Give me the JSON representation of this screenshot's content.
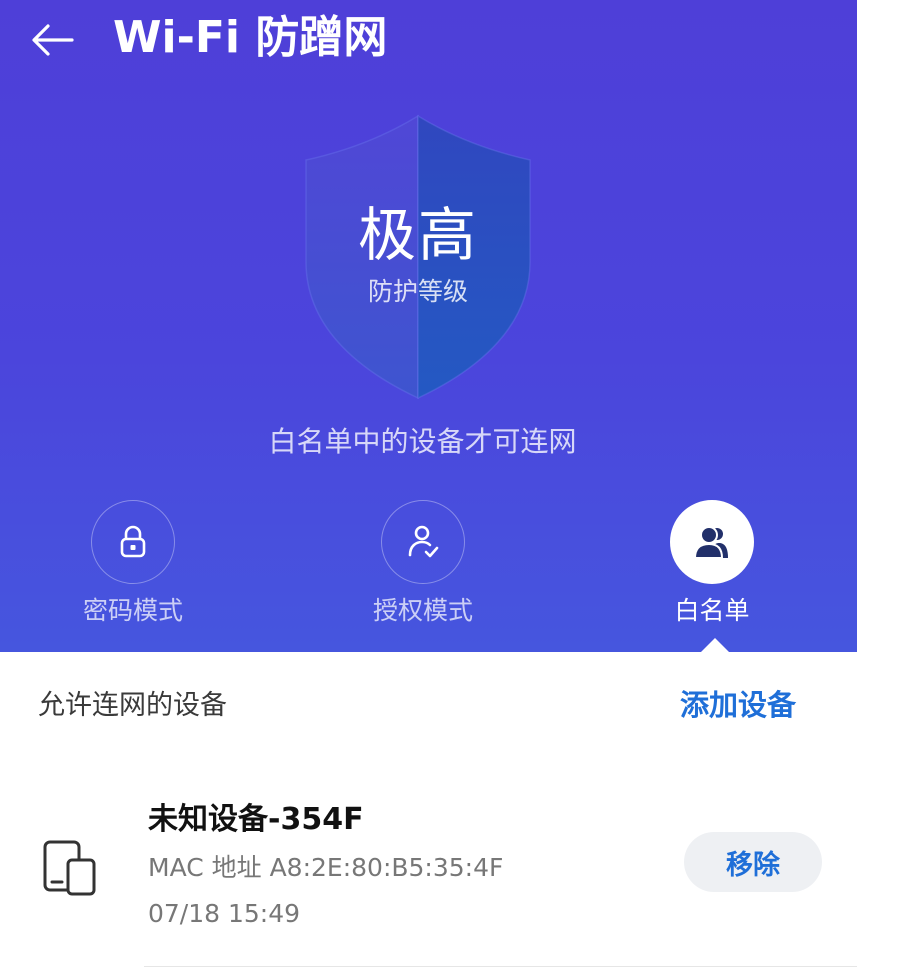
{
  "header": {
    "title": "Wi-Fi 防蹭网",
    "back_icon": "back-arrow-icon"
  },
  "shield": {
    "level": "极高",
    "subtitle": "防护等级"
  },
  "mode_description": "白名单中的设备才可连网",
  "modes": [
    {
      "label": "密码模式",
      "icon": "lock-icon",
      "active": false
    },
    {
      "label": "授权模式",
      "icon": "user-check-icon",
      "active": false
    },
    {
      "label": "白名单",
      "icon": "users-icon",
      "active": true
    }
  ],
  "devices_section": {
    "title": "允许连网的设备",
    "add_label": "添加设备"
  },
  "devices": [
    {
      "name": "未知设备-354F",
      "mac": "MAC 地址 A8:2E:80:B5:35:4F",
      "time": "07/18 15:49",
      "remove_label": "移除",
      "icon": "devices-icon"
    }
  ],
  "colors": {
    "header_bg": "#4d44da",
    "accent": "#1f6fd8",
    "shield_dark": "#2f56c7",
    "shield_light": "#4b54d6"
  }
}
